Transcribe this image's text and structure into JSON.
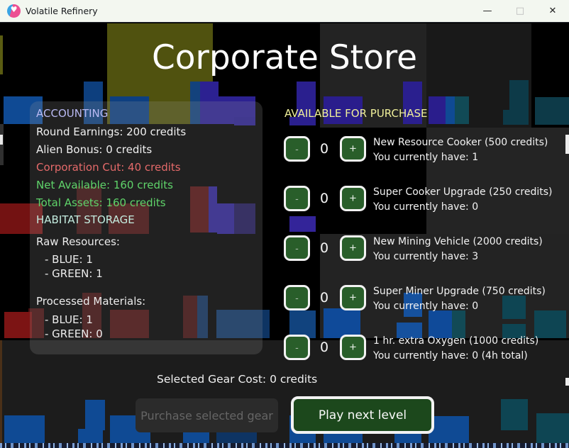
{
  "titlebar": {
    "title": "Volatile Refinery",
    "minimize_icon": "—",
    "maximize_icon": "□",
    "close_icon": "✕"
  },
  "store": {
    "title": "Corporate Store"
  },
  "accounting": {
    "header": "ACCOUNTING",
    "rows": [
      {
        "label": "Round Earnings: 200 credits",
        "tone": "default"
      },
      {
        "label": "Alien Bonus: 0 credits",
        "tone": "default"
      },
      {
        "label": "Corporation Cut: 40 credits",
        "tone": "negative"
      },
      {
        "label": "Net Available: 160 credits",
        "tone": "positive"
      },
      {
        "label": "Total Assets: 160 credits",
        "tone": "positive"
      }
    ]
  },
  "storage": {
    "header": "HABITAT STORAGE",
    "raw_title": "Raw Resources:",
    "raw_items": [
      "- BLUE: 1",
      "- GREEN: 1"
    ],
    "processed_title": "Processed Materials:",
    "processed_items": [
      "- BLUE: 1",
      "- GREEN: 0"
    ]
  },
  "purchase": {
    "header": "AVAILABLE FOR PURCHASE",
    "minus_icon": "-",
    "plus_icon": "+",
    "items": [
      {
        "qty": "0",
        "name": "New Resource Cooker (500 credits)",
        "have": "You currently have: 1"
      },
      {
        "qty": "0",
        "name": "Super Cooker Upgrade (250 credits)",
        "have": "You currently have: 0"
      },
      {
        "qty": "0",
        "name": "New Mining Vehicle (2000 credits)",
        "have": "You currently have: 3"
      },
      {
        "qty": "0",
        "name": "Super Miner Upgrade (750 credits)",
        "have": "You currently have: 0"
      },
      {
        "qty": "0",
        "name": "1 hr. extra Oxygen (1000 credits)",
        "have": "You currently have: 0 (4h total)"
      }
    ]
  },
  "footer": {
    "selected_cost": "Selected Gear Cost: 0 credits",
    "purchase_label": "Purchase selected gear",
    "play_label": "Play next level"
  },
  "colors": {
    "accent_lavender": "#b9b9f2",
    "accent_cyan": "#c4ecdf",
    "accent_yellow": "#efef9a",
    "negative_red": "#e56a6a",
    "positive_green": "#5fd46a",
    "button_green": "#295e2a",
    "play_green": "#1c481c",
    "tile_blue": "#0f4a94",
    "tile_red": "#731212",
    "tile_olive": "#50520f",
    "tile_teal": "#0d3a48",
    "tile_indigo": "#2c2191"
  }
}
